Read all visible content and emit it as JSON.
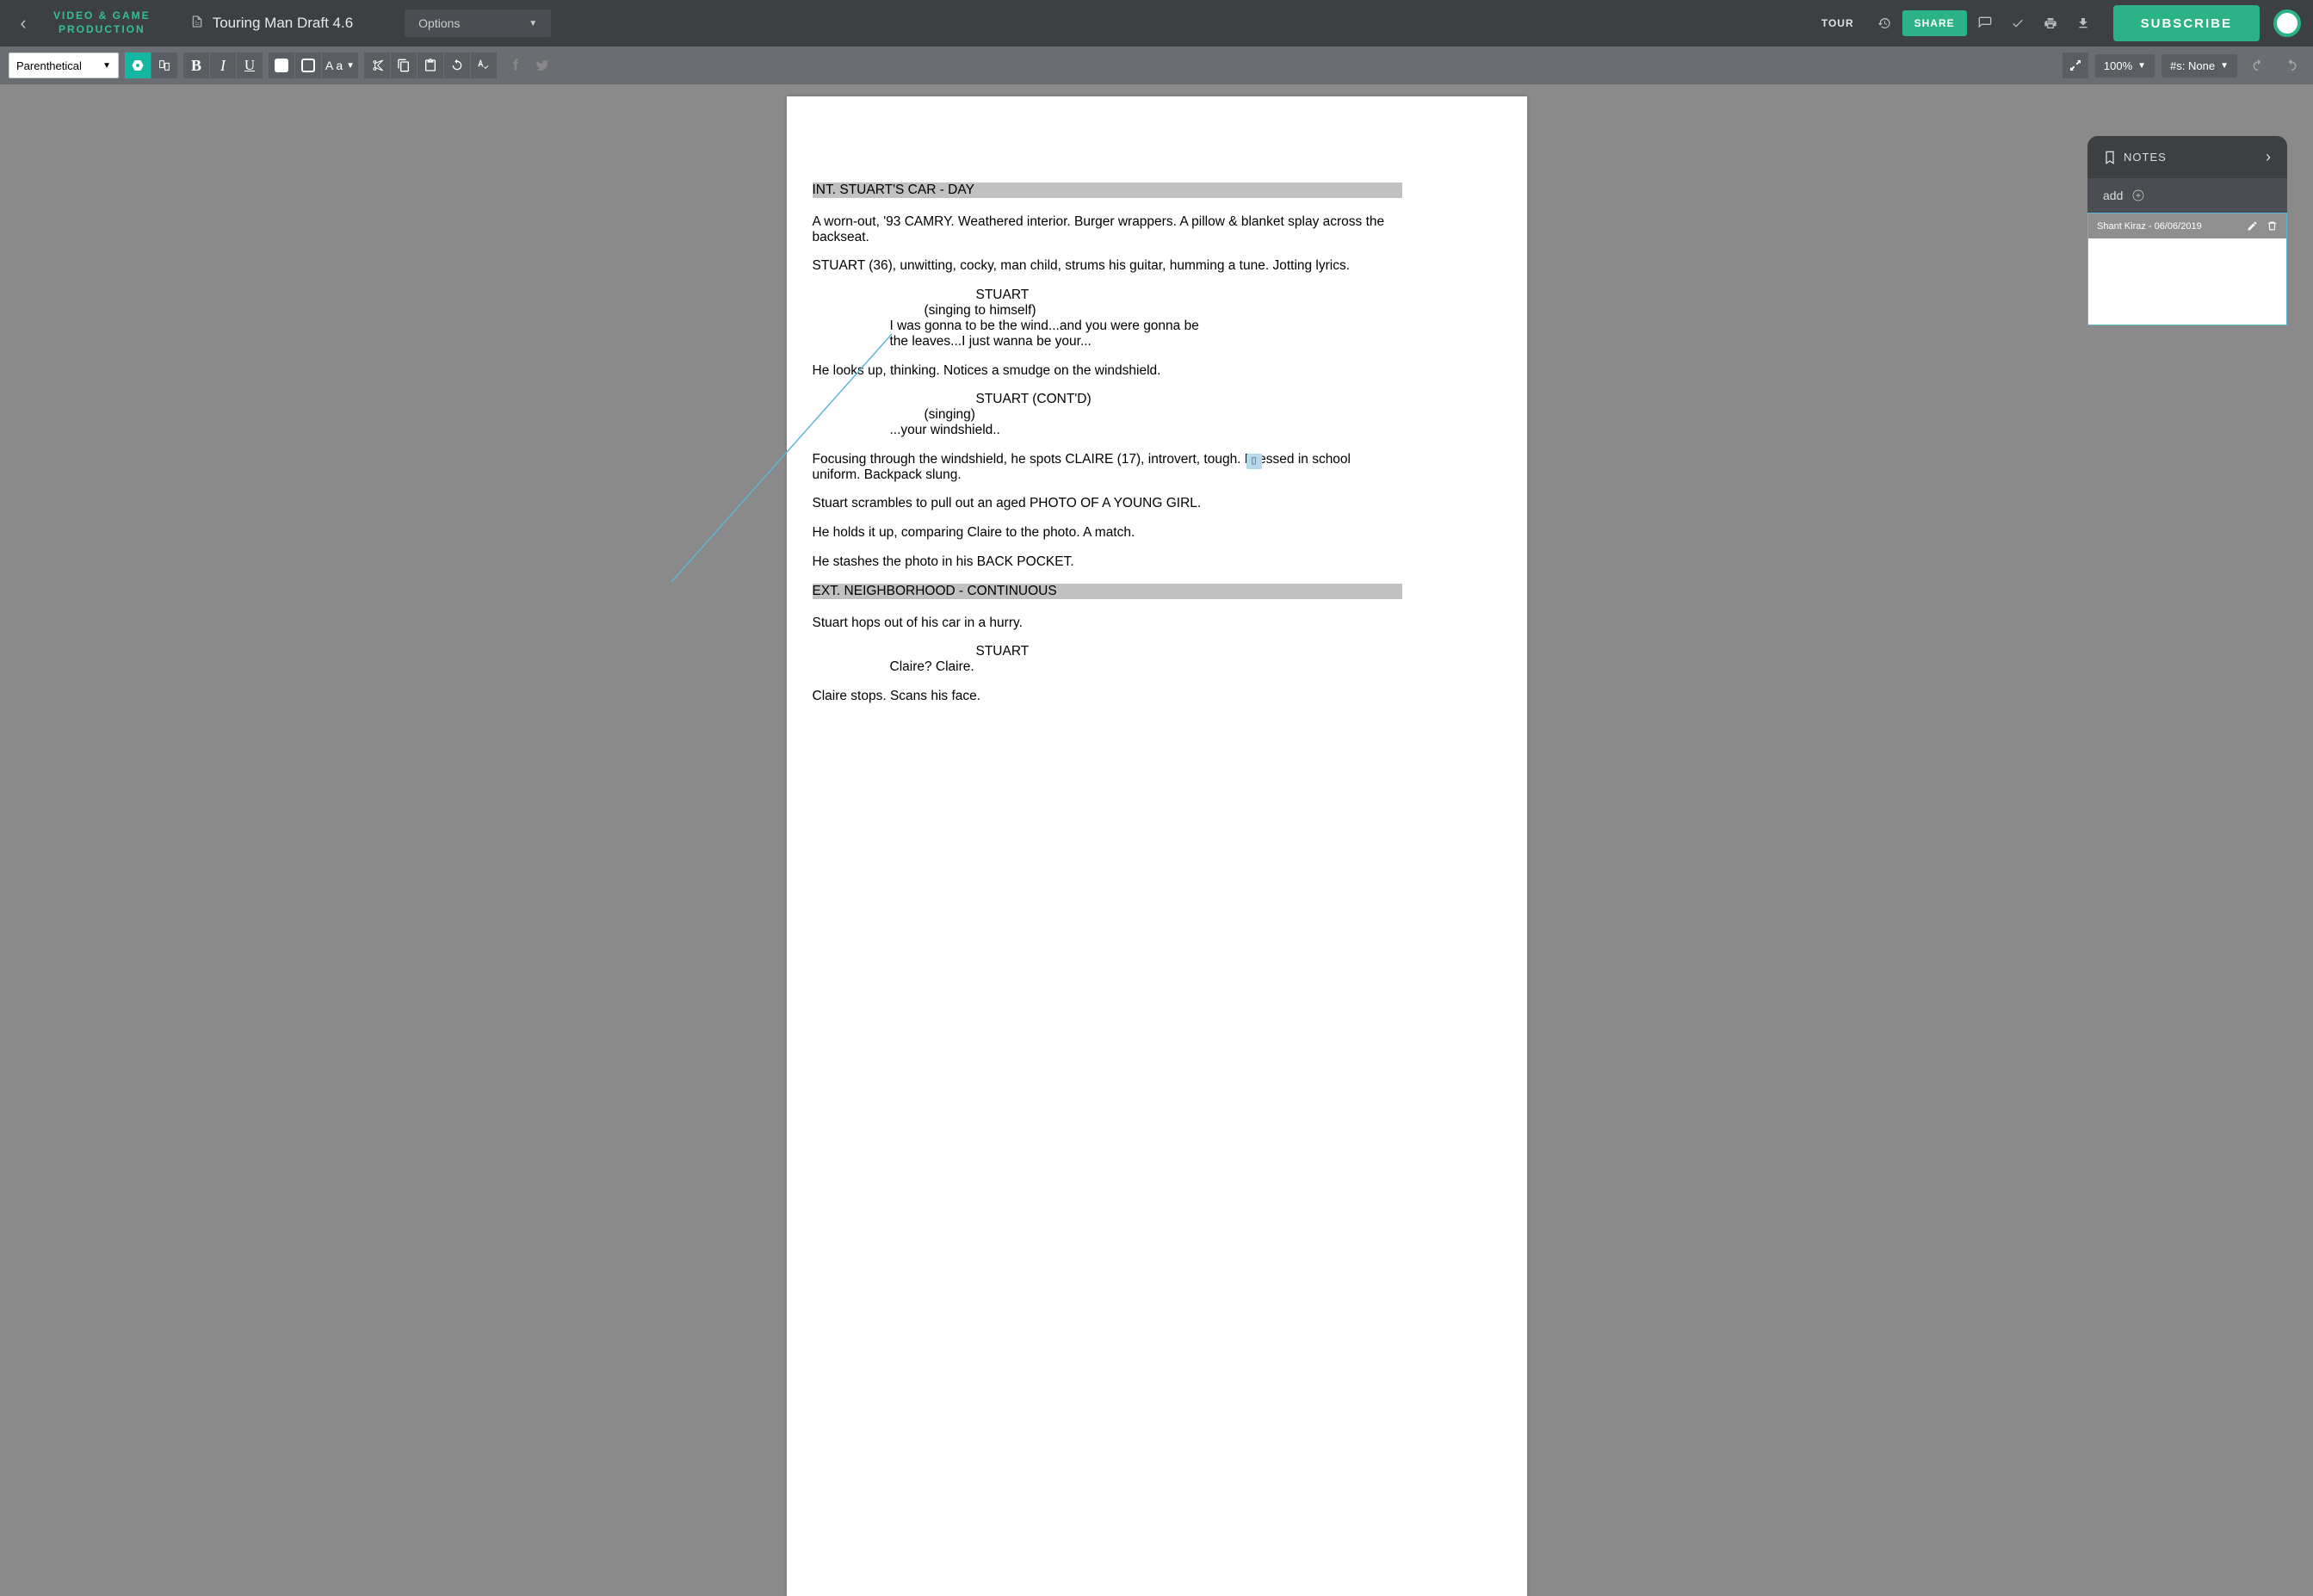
{
  "header": {
    "brand_line1": "VIDEO & GAME",
    "brand_line2": "PRODUCTION",
    "doc_title": "Touring Man Draft 4.6",
    "options": "Options",
    "tour": "TOUR",
    "share": "SHARE",
    "subscribe": "SUBSCRIBE"
  },
  "toolbar": {
    "element_type": "Parenthetical",
    "case_label": "A a",
    "zoom": "100%",
    "pounds": "#s: None"
  },
  "notes": {
    "title": "NOTES",
    "add": "add",
    "card_author": "Shant Kiraz - 06/06/2019"
  },
  "script": {
    "slug1": "INT. STUART'S CAR - DAY",
    "a1": "A worn-out, '93 CAMRY. Weathered interior. Burger wrappers. A pillow & blanket splay across the backseat.",
    "a2": "STUART (36), unwitting, cocky, man child, strums his guitar, humming a tune. Jotting lyrics.",
    "c1": "STUART",
    "p1": "(singing to himself)",
    "d1": "I was gonna to be the wind...and you were gonna be the leaves...I just wanna be your...",
    "a3": "He looks up, thinking. Notices a smudge on the windshield.",
    "c2": "STUART (CONT'D)",
    "p2": "(singing)",
    "d2": "...your windshield..",
    "a4": "Focusing through the windshield, he spots CLAIRE (17), introvert, tough. Dressed in school uniform. Backpack slung.",
    "a5": "Stuart scrambles to pull out an aged PHOTO OF A YOUNG GIRL.",
    "a6": "He holds it up, comparing Claire to the photo. A match.",
    "a7": "He stashes the photo in his BACK POCKET.",
    "slug2": "EXT. NEIGHBORHOOD - CONTINUOUS",
    "a8": "Stuart hops out of his car in a hurry.",
    "c3": "STUART",
    "d3": "Claire? Claire.",
    "a9": "Claire stops. Scans his face."
  }
}
